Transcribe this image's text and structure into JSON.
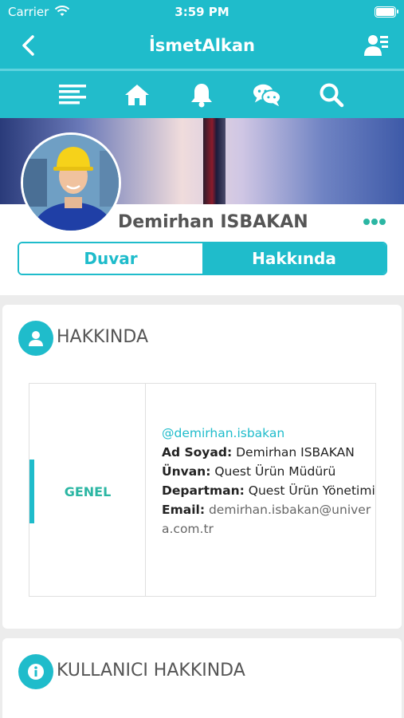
{
  "status_bar": {
    "carrier": "Carrier",
    "time": "3:59 PM"
  },
  "nav": {
    "title": "İsmetAlkan"
  },
  "toolbar": {
    "items": [
      "menu-icon",
      "home-icon",
      "bell-icon",
      "chat-icon",
      "search-icon"
    ]
  },
  "profile": {
    "name": "Demirhan ISBAKAN",
    "tabs": [
      {
        "label": "Duvar",
        "active": false
      },
      {
        "label": "Hakkında",
        "active": true
      }
    ]
  },
  "about": {
    "title": "HAKKINDA",
    "category": "GENEL",
    "handle": "@demirhan.isbakan",
    "fields": [
      {
        "key": "Ad Soyad:",
        "value": "Demirhan ISBAKAN"
      },
      {
        "key": "Ünvan:",
        "value": "Quest Ürün Müdürü"
      },
      {
        "key": "Departman:",
        "value": "Quest Ürün Yönetimi"
      },
      {
        "key": "Email:",
        "value": "demirhan.isbakan@univera.com.tr"
      }
    ]
  },
  "user_about": {
    "title": "KULLANICI HAKKINDA"
  },
  "colors": {
    "primary": "#1fbccb",
    "accent_text": "#2bb6a3"
  }
}
